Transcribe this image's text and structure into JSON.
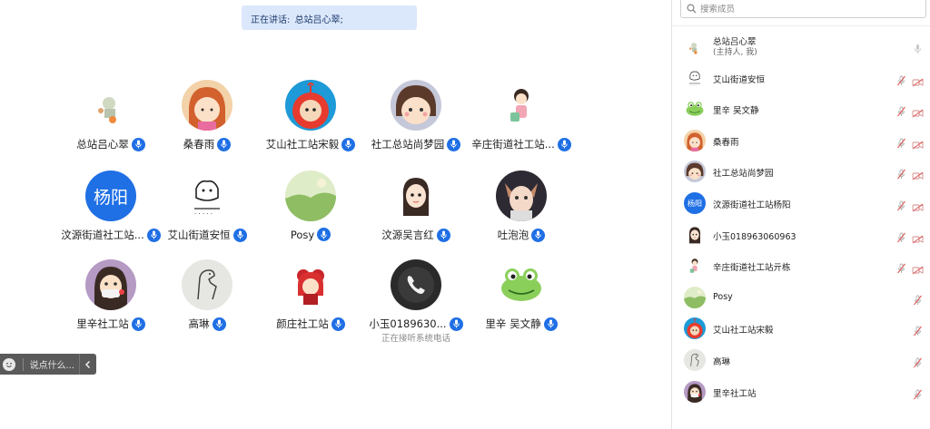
{
  "speaking": {
    "prefix": "正在讲话:",
    "names": "总站吕心翠;"
  },
  "grid": [
    {
      "name": "总站吕心翠",
      "avatar": "cartoon-figure-avatar"
    },
    {
      "name": "桑春雨",
      "avatar": "girl-cartoon-avatar"
    },
    {
      "name": "艾山社工站宋毅",
      "avatar": "teletubby-avatar"
    },
    {
      "name": "社工总站尚梦园",
      "avatar": "cartoon-face-avatar"
    },
    {
      "name": "辛庄街道社工站...",
      "avatar": "cartoon-girl-avatar"
    },
    {
      "name": "汶源街道社工站...",
      "avatar": "initials-avatar",
      "initials": "杨阳"
    },
    {
      "name": "艾山街道安恒",
      "avatar": "doodle-avatar"
    },
    {
      "name": "Posy",
      "avatar": "landscape-avatar"
    },
    {
      "name": "汶源吴言红",
      "avatar": "anime-girl-avatar"
    },
    {
      "name": "吐泡泡",
      "avatar": "cat-ears-girl-avatar"
    },
    {
      "name": "里辛社工站",
      "avatar": "masked-girl-avatar"
    },
    {
      "name": "高琳",
      "avatar": "sketch-dinosaur-avatar"
    },
    {
      "name": "颜庄社工站",
      "avatar": "red-hair-doll-avatar"
    },
    {
      "name": "小玉0189630...",
      "avatar": "phone-avatar",
      "sub": "正在接听系统电话"
    },
    {
      "name": "里辛 吴文静",
      "avatar": "frog-avatar"
    }
  ],
  "chat": {
    "placeholder": "说点什么..."
  },
  "panel": {
    "search_placeholder": "搜索成员",
    "members": [
      {
        "name": "总站吕心翠",
        "sub": "(主持人, 我)",
        "mic": "on",
        "cam": "none"
      },
      {
        "name": "艾山街道安恒",
        "mic": "muted",
        "cam": "off"
      },
      {
        "name": "里辛 吴文静",
        "mic": "muted",
        "cam": "off"
      },
      {
        "name": "桑春雨",
        "mic": "muted",
        "cam": "off"
      },
      {
        "name": "社工总站尚梦园",
        "mic": "muted",
        "cam": "off"
      },
      {
        "name": "汶源街道社工站杨阳",
        "mic": "muted",
        "cam": "off",
        "initials": "杨阳"
      },
      {
        "name": "小玉018963060963",
        "mic": "muted",
        "cam": "off"
      },
      {
        "name": "辛庄街道社工站亓栋",
        "mic": "muted",
        "cam": "off"
      },
      {
        "name": "Posy",
        "mic": "muted",
        "cam": "none"
      },
      {
        "name": "艾山社工站宋毅",
        "mic": "muted",
        "cam": "none"
      },
      {
        "name": "高琳",
        "mic": "muted",
        "cam": "none"
      },
      {
        "name": "里辛社工站",
        "mic": "muted",
        "cam": "none"
      }
    ]
  },
  "colors": {
    "accent": "#1f6fe5",
    "muted": "#e05a5a",
    "speaking_bg": "#dbe8fb"
  }
}
